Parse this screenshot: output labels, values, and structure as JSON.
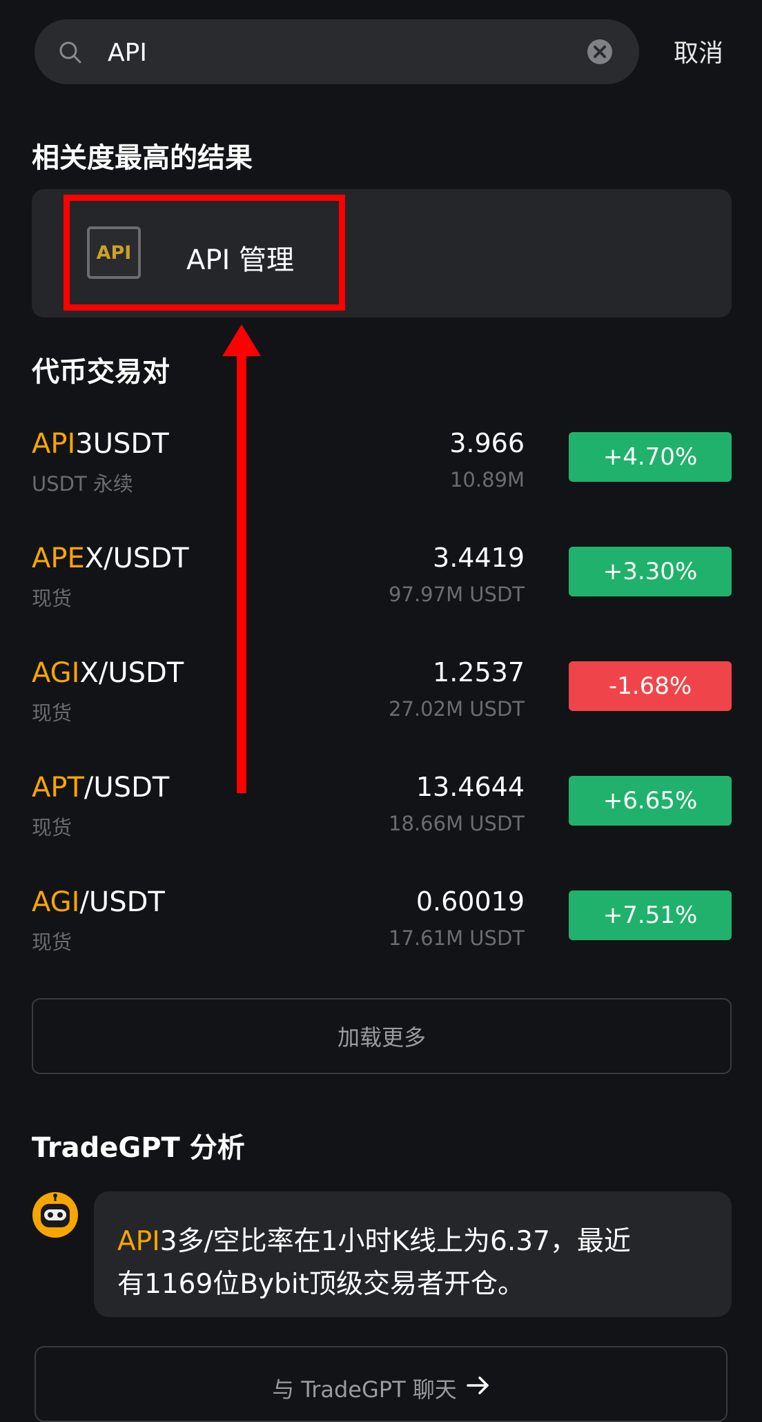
{
  "search": {
    "value": "API",
    "cancel_label": "取消"
  },
  "top_result": {
    "section_title": "相关度最高的结果",
    "logo_text": "API",
    "label": "API 管理"
  },
  "pairs_section": {
    "title": "代币交易对",
    "items": [
      {
        "hl": "API",
        "rest": "3USDT",
        "sub": "USDT 永续",
        "price": "3.966",
        "volume": "10.89M",
        "change": "+4.70%"
      },
      {
        "hl": "APE",
        "rest": "X/USDT",
        "sub": "现货",
        "price": "3.4419",
        "volume": "97.97M USDT",
        "change": "+3.30%"
      },
      {
        "hl": "AGI",
        "rest": "X/USDT",
        "sub": "现货",
        "price": "1.2537",
        "volume": "27.02M USDT",
        "change": "-1.68%"
      },
      {
        "hl": "APT",
        "rest": "/USDT",
        "sub": "现货",
        "price": "13.4644",
        "volume": "18.66M USDT",
        "change": "+6.65%"
      },
      {
        "hl": "AGI",
        "rest": "/USDT",
        "sub": "现货",
        "price": "0.60019",
        "volume": "17.61M USDT",
        "change": "+7.51%"
      }
    ],
    "load_more_label": "加载更多"
  },
  "tradegpt": {
    "title": "TradeGPT 分析",
    "message_hl": "API",
    "message_line1_rest": "3多/空比率在1小时K线上为6.37，最近",
    "message_line2": "有1169位Bybit顶级交易者开仓。",
    "chat_label": "与 TradeGPT 聊天"
  },
  "colors": {
    "accent": "#f7a600",
    "up": "#20b26c",
    "down": "#ef454a",
    "annotation": "#ff0000"
  }
}
